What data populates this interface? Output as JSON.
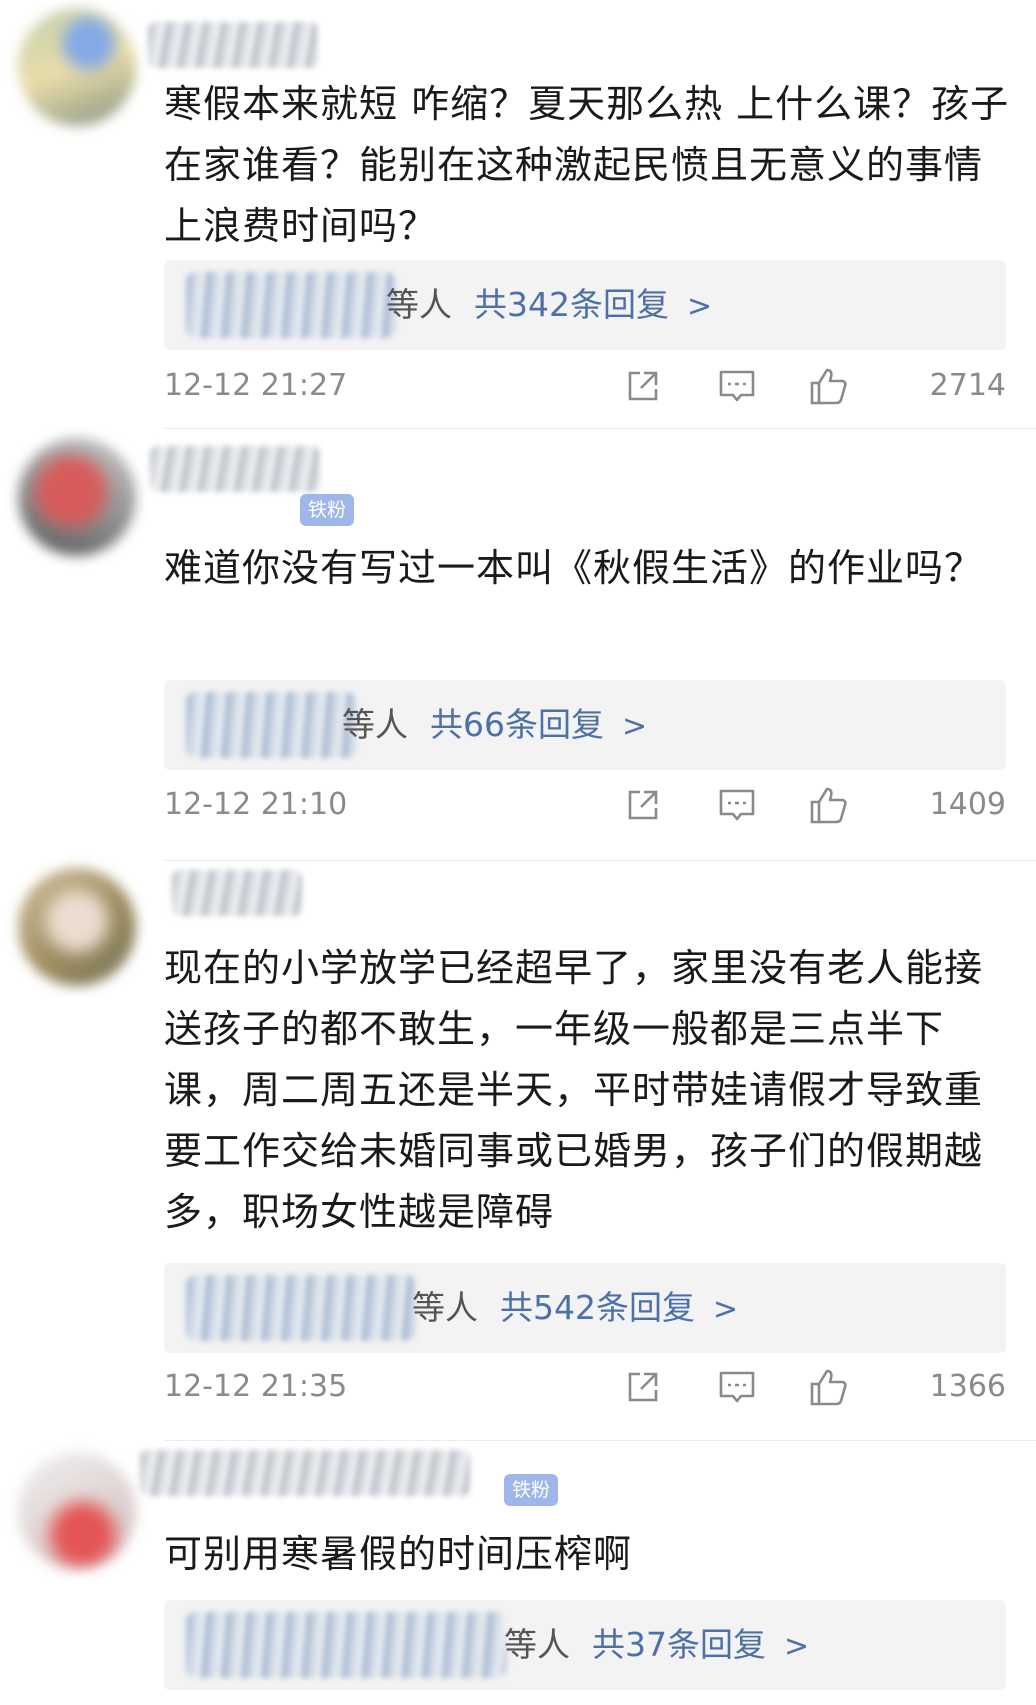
{
  "comments": [
    {
      "text": "寒假本来就短 咋缩？夏天那么热 上什么课？孩子在家谁看？能别在这种激起民愤且无意义的事情上浪费时间吗？",
      "reply_who": "等人",
      "reply_count": "共342条回复",
      "time": "12-12 21:27",
      "likes": "2714",
      "badge": ""
    },
    {
      "text": "难道你没有写过一本叫《秋假生活》的作业吗？",
      "reply_who": "等人",
      "reply_count": "共66条回复",
      "time": "12-12 21:10",
      "likes": "1409",
      "badge": "铁粉"
    },
    {
      "text": "现在的小学放学已经超早了，家里没有老人能接送孩子的都不敢生，一年级一般都是三点半下课，周二周五还是半天，平时带娃请假才导致重要工作交给未婚同事或已婚男，孩子们的假期越多，职场女性越是障碍",
      "reply_who": "等人",
      "reply_count": "共542条回复",
      "time": "12-12 21:35",
      "likes": "1366",
      "badge": ""
    },
    {
      "text": "可别用寒暑假的时间压榨啊",
      "reply_who": "等人",
      "reply_count": "共37条回复",
      "time": "",
      "likes": "",
      "badge": "铁粉"
    }
  ],
  "icons": {
    "share": "share-icon",
    "comment": "comment-icon",
    "like": "thumbs-up-icon",
    "chevron": "chevron-right-icon"
  },
  "colors": {
    "link": "#4d70a8",
    "badge": "#9fb7e8",
    "meta": "#8a8a8a",
    "reply_bg": "#f3f3f3"
  }
}
